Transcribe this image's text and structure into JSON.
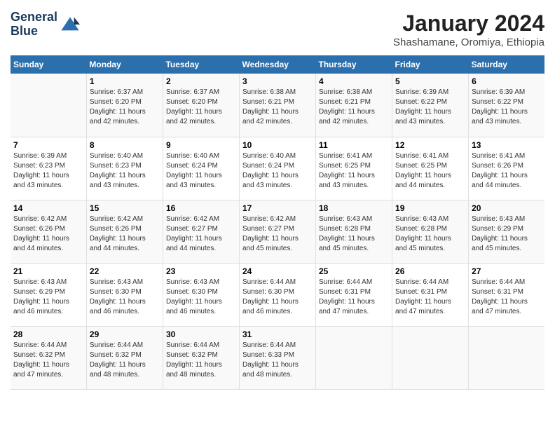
{
  "logo": {
    "line1": "General",
    "line2": "Blue"
  },
  "title": "January 2024",
  "subtitle": "Shashamane, Oromiya, Ethiopia",
  "days_header": [
    "Sunday",
    "Monday",
    "Tuesday",
    "Wednesday",
    "Thursday",
    "Friday",
    "Saturday"
  ],
  "weeks": [
    [
      {
        "num": "",
        "info": ""
      },
      {
        "num": "1",
        "info": "Sunrise: 6:37 AM\nSunset: 6:20 PM\nDaylight: 11 hours\nand 42 minutes."
      },
      {
        "num": "2",
        "info": "Sunrise: 6:37 AM\nSunset: 6:20 PM\nDaylight: 11 hours\nand 42 minutes."
      },
      {
        "num": "3",
        "info": "Sunrise: 6:38 AM\nSunset: 6:21 PM\nDaylight: 11 hours\nand 42 minutes."
      },
      {
        "num": "4",
        "info": "Sunrise: 6:38 AM\nSunset: 6:21 PM\nDaylight: 11 hours\nand 42 minutes."
      },
      {
        "num": "5",
        "info": "Sunrise: 6:39 AM\nSunset: 6:22 PM\nDaylight: 11 hours\nand 43 minutes."
      },
      {
        "num": "6",
        "info": "Sunrise: 6:39 AM\nSunset: 6:22 PM\nDaylight: 11 hours\nand 43 minutes."
      }
    ],
    [
      {
        "num": "7",
        "info": "Sunrise: 6:39 AM\nSunset: 6:23 PM\nDaylight: 11 hours\nand 43 minutes."
      },
      {
        "num": "8",
        "info": "Sunrise: 6:40 AM\nSunset: 6:23 PM\nDaylight: 11 hours\nand 43 minutes."
      },
      {
        "num": "9",
        "info": "Sunrise: 6:40 AM\nSunset: 6:24 PM\nDaylight: 11 hours\nand 43 minutes."
      },
      {
        "num": "10",
        "info": "Sunrise: 6:40 AM\nSunset: 6:24 PM\nDaylight: 11 hours\nand 43 minutes."
      },
      {
        "num": "11",
        "info": "Sunrise: 6:41 AM\nSunset: 6:25 PM\nDaylight: 11 hours\nand 43 minutes."
      },
      {
        "num": "12",
        "info": "Sunrise: 6:41 AM\nSunset: 6:25 PM\nDaylight: 11 hours\nand 44 minutes."
      },
      {
        "num": "13",
        "info": "Sunrise: 6:41 AM\nSunset: 6:26 PM\nDaylight: 11 hours\nand 44 minutes."
      }
    ],
    [
      {
        "num": "14",
        "info": "Sunrise: 6:42 AM\nSunset: 6:26 PM\nDaylight: 11 hours\nand 44 minutes."
      },
      {
        "num": "15",
        "info": "Sunrise: 6:42 AM\nSunset: 6:26 PM\nDaylight: 11 hours\nand 44 minutes."
      },
      {
        "num": "16",
        "info": "Sunrise: 6:42 AM\nSunset: 6:27 PM\nDaylight: 11 hours\nand 44 minutes."
      },
      {
        "num": "17",
        "info": "Sunrise: 6:42 AM\nSunset: 6:27 PM\nDaylight: 11 hours\nand 45 minutes."
      },
      {
        "num": "18",
        "info": "Sunrise: 6:43 AM\nSunset: 6:28 PM\nDaylight: 11 hours\nand 45 minutes."
      },
      {
        "num": "19",
        "info": "Sunrise: 6:43 AM\nSunset: 6:28 PM\nDaylight: 11 hours\nand 45 minutes."
      },
      {
        "num": "20",
        "info": "Sunrise: 6:43 AM\nSunset: 6:29 PM\nDaylight: 11 hours\nand 45 minutes."
      }
    ],
    [
      {
        "num": "21",
        "info": "Sunrise: 6:43 AM\nSunset: 6:29 PM\nDaylight: 11 hours\nand 46 minutes."
      },
      {
        "num": "22",
        "info": "Sunrise: 6:43 AM\nSunset: 6:30 PM\nDaylight: 11 hours\nand 46 minutes."
      },
      {
        "num": "23",
        "info": "Sunrise: 6:43 AM\nSunset: 6:30 PM\nDaylight: 11 hours\nand 46 minutes."
      },
      {
        "num": "24",
        "info": "Sunrise: 6:44 AM\nSunset: 6:30 PM\nDaylight: 11 hours\nand 46 minutes."
      },
      {
        "num": "25",
        "info": "Sunrise: 6:44 AM\nSunset: 6:31 PM\nDaylight: 11 hours\nand 47 minutes."
      },
      {
        "num": "26",
        "info": "Sunrise: 6:44 AM\nSunset: 6:31 PM\nDaylight: 11 hours\nand 47 minutes."
      },
      {
        "num": "27",
        "info": "Sunrise: 6:44 AM\nSunset: 6:31 PM\nDaylight: 11 hours\nand 47 minutes."
      }
    ],
    [
      {
        "num": "28",
        "info": "Sunrise: 6:44 AM\nSunset: 6:32 PM\nDaylight: 11 hours\nand 47 minutes."
      },
      {
        "num": "29",
        "info": "Sunrise: 6:44 AM\nSunset: 6:32 PM\nDaylight: 11 hours\nand 48 minutes."
      },
      {
        "num": "30",
        "info": "Sunrise: 6:44 AM\nSunset: 6:32 PM\nDaylight: 11 hours\nand 48 minutes."
      },
      {
        "num": "31",
        "info": "Sunrise: 6:44 AM\nSunset: 6:33 PM\nDaylight: 11 hours\nand 48 minutes."
      },
      {
        "num": "",
        "info": ""
      },
      {
        "num": "",
        "info": ""
      },
      {
        "num": "",
        "info": ""
      }
    ]
  ]
}
